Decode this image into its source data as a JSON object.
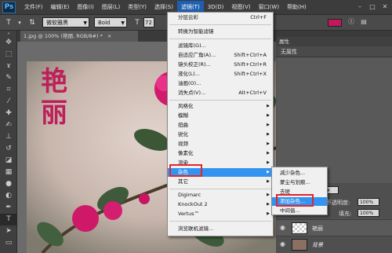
{
  "app": {
    "logo": "Ps",
    "menus": [
      "文件(F)",
      "编辑(E)",
      "图像(I)",
      "图层(L)",
      "类型(Y)",
      "选择(S)",
      "滤镜(T)",
      "3D(D)",
      "视图(V)",
      "窗口(W)",
      "帮助(H)"
    ],
    "active_menu": "滤镜(T)",
    "window_controls": [
      "–",
      "□",
      "✕"
    ]
  },
  "options_bar": {
    "tool_icon": "type-tool-icon",
    "font_family": "微软雅黑",
    "font_style": "Bold",
    "font_size": "72",
    "text_color": "#c3185c"
  },
  "document": {
    "tab_title": "1.jpg @ 100% (艳丽, RGB/8#) *",
    "tab_close": "×",
    "overlay_text": [
      "艳",
      "丽"
    ],
    "overlay_color": "#bd1f5a"
  },
  "filter_menu": {
    "items": [
      {
        "label": "分层云彩",
        "shortcut": "Ctrl+F",
        "disabled": false
      },
      {
        "separator": true
      },
      {
        "label": "转换为智能滤镜",
        "shortcut": "",
        "disabled": false
      },
      {
        "separator": true
      },
      {
        "label": "滤镜库(G)...",
        "shortcut": "",
        "disabled": false
      },
      {
        "label": "自适应广角(A)...",
        "shortcut": "Shift+Ctrl+A",
        "disabled": false
      },
      {
        "label": "镜头校正(R)...",
        "shortcut": "Shift+Ctrl+R",
        "disabled": false
      },
      {
        "label": "液化(L)...",
        "shortcut": "Shift+Ctrl+X",
        "disabled": false
      },
      {
        "label": "油画(O)...",
        "shortcut": "",
        "disabled": false
      },
      {
        "label": "消失点(V)...",
        "shortcut": "Alt+Ctrl+V",
        "disabled": false
      },
      {
        "separator": true
      },
      {
        "label": "风格化",
        "submenu": true
      },
      {
        "label": "模糊",
        "submenu": true
      },
      {
        "label": "扭曲",
        "submenu": true
      },
      {
        "label": "锐化",
        "submenu": true
      },
      {
        "label": "视频",
        "submenu": true
      },
      {
        "label": "像素化",
        "submenu": true
      },
      {
        "label": "渲染",
        "submenu": true
      },
      {
        "label": "杂色",
        "submenu": true,
        "highlight": true
      },
      {
        "label": "其它",
        "submenu": true
      },
      {
        "separator": true
      },
      {
        "label": "Digimarc",
        "submenu": true
      },
      {
        "label": "KnockOut 2",
        "submenu": true
      },
      {
        "label": "Vertus™",
        "submenu": true
      },
      {
        "separator": true
      },
      {
        "label": "浏览联机滤镜...",
        "shortcut": ""
      }
    ]
  },
  "noise_submenu": {
    "items": [
      {
        "label": "减少杂色..."
      },
      {
        "label": "蒙尘与划痕..."
      },
      {
        "label": "去斑"
      },
      {
        "label": "添加杂色...",
        "highlight": true
      },
      {
        "label": "中间值..."
      }
    ]
  },
  "properties_panel": {
    "title": "属性",
    "subtitle": "无属性"
  },
  "layers_panel": {
    "opacity_label": "不透明度:",
    "opacity_value": "100%",
    "fill_label": "填充:",
    "fill_value": "100%",
    "layers": [
      {
        "name": "艳丽",
        "selected": false
      },
      {
        "name": "背景",
        "selected": false
      }
    ]
  },
  "tools": [
    "move-icon",
    "marquee-icon",
    "lasso-icon",
    "quick-select-icon",
    "crop-icon",
    "eyedropper-icon",
    "healing-icon",
    "brush-icon",
    "stamp-icon",
    "history-brush-icon",
    "eraser-icon",
    "gradient-icon",
    "blur-icon",
    "dodge-icon",
    "pen-icon",
    "type-icon",
    "path-select-icon",
    "shape-icon",
    "hand-icon"
  ]
}
